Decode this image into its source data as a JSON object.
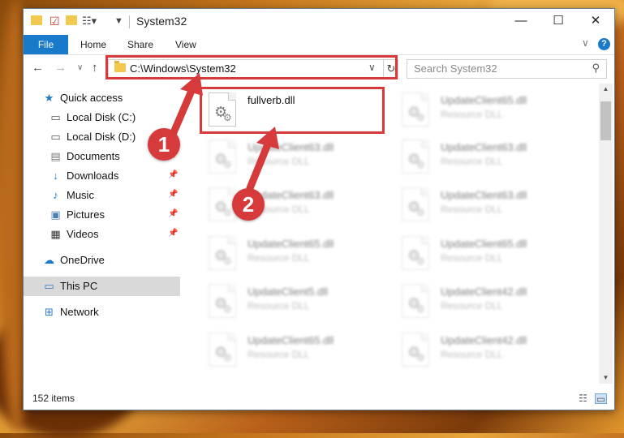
{
  "window": {
    "title": "System32",
    "controls": {
      "minimize": "—",
      "maximize": "☐",
      "close": "✕"
    }
  },
  "ribbon": {
    "tabs": [
      "File",
      "Home",
      "Share",
      "View"
    ],
    "expand_icon": "chevron-down-icon",
    "help_label": "?"
  },
  "nav": {
    "address": "C:\\Windows\\System32",
    "search_placeholder": "Search System32"
  },
  "sidebar": {
    "items": [
      {
        "label": "Quick access",
        "icon": "star-icon"
      },
      {
        "label": "Local Disk (C:)",
        "icon": "drive-icon"
      },
      {
        "label": "Local Disk (D:)",
        "icon": "drive-icon"
      },
      {
        "label": "Documents",
        "icon": "documents-icon"
      },
      {
        "label": "Downloads",
        "icon": "download-icon"
      },
      {
        "label": "Music",
        "icon": "music-icon"
      },
      {
        "label": "Pictures",
        "icon": "pictures-icon"
      },
      {
        "label": "Videos",
        "icon": "videos-icon"
      },
      {
        "label": "OneDrive",
        "icon": "cloud-icon"
      },
      {
        "label": "This PC",
        "icon": "computer-icon",
        "selected": true
      },
      {
        "label": "Network",
        "icon": "network-icon"
      }
    ]
  },
  "files": {
    "left": [
      {
        "name": "fullverb.dll",
        "type": ""
      },
      {
        "name": "UpdateClient63.dll",
        "type": "Resource DLL"
      },
      {
        "name": "UpdateClient63.dll",
        "type": "Resource DLL"
      },
      {
        "name": "UpdateClient65.dll",
        "type": "Resource DLL"
      },
      {
        "name": "UpdateClient5.dll",
        "type": "Resource DLL"
      },
      {
        "name": "UpdateClient65.dll",
        "type": "Resource DLL"
      }
    ],
    "right": [
      {
        "name": "UpdateClient65.dll",
        "type": "Resource DLL"
      },
      {
        "name": "UpdateClient63.dll",
        "type": "Resource DLL"
      },
      {
        "name": "UpdateClient63.dll",
        "type": "Resource DLL"
      },
      {
        "name": "UpdateClient65.dll",
        "type": "Resource DLL"
      },
      {
        "name": "UpdateClient42.dll",
        "type": "Resource DLL"
      },
      {
        "name": "UpdateClient42.dll",
        "type": "Resource DLL"
      }
    ]
  },
  "status": {
    "item_count": "152 items"
  },
  "annotations": {
    "callout1": "1",
    "callout2": "2",
    "color": "#d63a3a"
  }
}
